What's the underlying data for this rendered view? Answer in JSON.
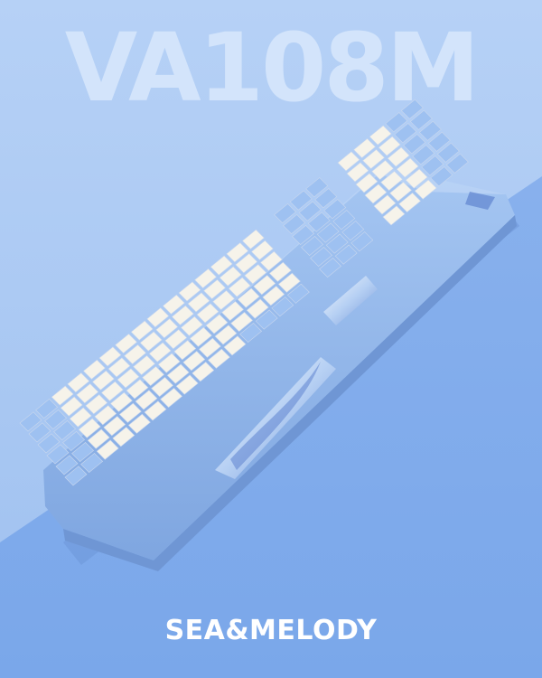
{
  "headline": "VA108M",
  "subtitle": "SEA&MELODY",
  "colors": {
    "background": "#a9c9f4",
    "diagonal_band": "#7aa7ea",
    "headline": "#d3e4fb",
    "subtitle": "#ffffff",
    "keyboard_case": "#8fb5ea",
    "keycap_white": "#f6f3ea",
    "keycap_blue": "#9ec1f1"
  }
}
